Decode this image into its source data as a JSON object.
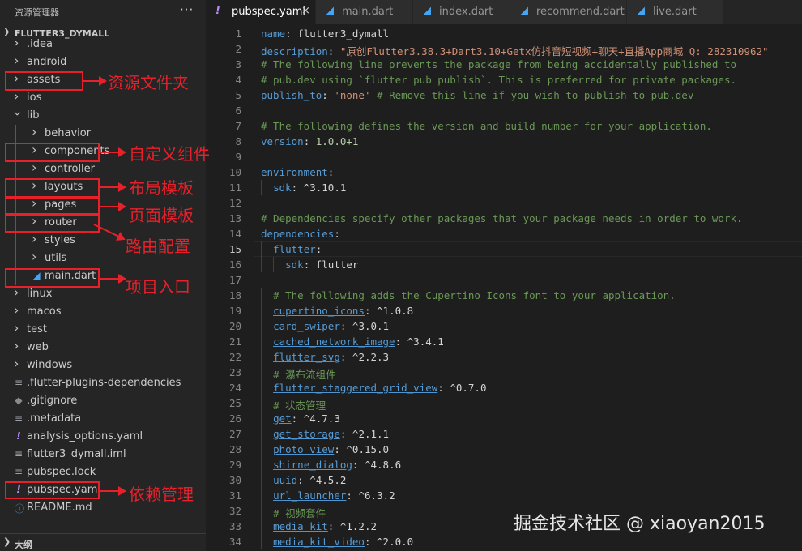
{
  "sidebar": {
    "title": "资源管理器",
    "more": "···",
    "root": "FLUTTER3_DYMALL",
    "outline": "大纲",
    "items": [
      {
        "label": ".idea",
        "kind": "folder"
      },
      {
        "label": "android",
        "kind": "folder"
      },
      {
        "label": "assets",
        "kind": "folder"
      },
      {
        "label": "ios",
        "kind": "folder"
      },
      {
        "label": "lib",
        "kind": "folder-open"
      },
      {
        "label": "behavior",
        "kind": "folder"
      },
      {
        "label": "components",
        "kind": "folder"
      },
      {
        "label": "controller",
        "kind": "folder"
      },
      {
        "label": "layouts",
        "kind": "folder"
      },
      {
        "label": "pages",
        "kind": "folder"
      },
      {
        "label": "router",
        "kind": "folder"
      },
      {
        "label": "styles",
        "kind": "folder"
      },
      {
        "label": "utils",
        "kind": "folder"
      },
      {
        "label": "main.dart",
        "kind": "dart"
      },
      {
        "label": "linux",
        "kind": "folder"
      },
      {
        "label": "macos",
        "kind": "folder"
      },
      {
        "label": "test",
        "kind": "folder"
      },
      {
        "label": "web",
        "kind": "folder"
      },
      {
        "label": "windows",
        "kind": "folder"
      },
      {
        "label": ".flutter-plugins-dependencies",
        "kind": "lines"
      },
      {
        "label": ".gitignore",
        "kind": "git"
      },
      {
        "label": ".metadata",
        "kind": "lines"
      },
      {
        "label": "analysis_options.yaml",
        "kind": "yaml"
      },
      {
        "label": "flutter3_dymall.iml",
        "kind": "lines"
      },
      {
        "label": "pubspec.lock",
        "kind": "lines"
      },
      {
        "label": "pubspec.yaml",
        "kind": "yaml"
      },
      {
        "label": "README.md",
        "kind": "info"
      }
    ]
  },
  "annotations": [
    {
      "label": "资源文件夹"
    },
    {
      "label": "自定义组件"
    },
    {
      "label": "布局模板"
    },
    {
      "label": "页面模板"
    },
    {
      "label": "路由配置"
    },
    {
      "label": "项目入口"
    },
    {
      "label": "依赖管理"
    }
  ],
  "tabs": [
    {
      "label": "pubspec.yaml",
      "icon": "!",
      "active": true,
      "close": "×"
    },
    {
      "label": "main.dart",
      "icon": "dart"
    },
    {
      "label": "index.dart",
      "icon": "dart"
    },
    {
      "label": "recommend.dart",
      "icon": "dart"
    },
    {
      "label": "live.dart",
      "icon": "dart"
    }
  ],
  "editor": {
    "current_line": 15,
    "lines": [
      [
        [
          "k",
          "name"
        ],
        [
          "p",
          ": "
        ],
        [
          "t",
          "flutter3_dymall"
        ]
      ],
      [
        [
          "k",
          "description"
        ],
        [
          "p",
          ": "
        ],
        [
          "s",
          "\"原创Flutter3.38.3+Dart3.10+Getx仿抖音短视频+聊天+直播App商城 Q: 282310962\""
        ]
      ],
      [
        [
          "c",
          "# The following line prevents the package from being accidentally published to"
        ]
      ],
      [
        [
          "c",
          "# pub.dev using `flutter pub publish`. This is preferred for private packages."
        ]
      ],
      [
        [
          "k",
          "publish_to"
        ],
        [
          "p",
          ": "
        ],
        [
          "s",
          "'none'"
        ],
        [
          "p",
          " "
        ],
        [
          "c",
          "# Remove this line if you wish to publish to pub.dev"
        ]
      ],
      [],
      [
        [
          "c",
          "# The following defines the version and build number for your application."
        ]
      ],
      [
        [
          "k",
          "version"
        ],
        [
          "p",
          ": "
        ],
        [
          "n",
          "1.0.0+1"
        ]
      ],
      [],
      [
        [
          "k",
          "environment"
        ],
        [
          "p",
          ":"
        ]
      ],
      [
        [
          "p",
          "  "
        ],
        [
          "k",
          "sdk"
        ],
        [
          "p",
          ": "
        ],
        [
          "t",
          "^3.10.1"
        ]
      ],
      [],
      [
        [
          "c",
          "# Dependencies specify other packages that your package needs in order to work."
        ]
      ],
      [
        [
          "k",
          "dependencies"
        ],
        [
          "p",
          ":"
        ]
      ],
      [
        [
          "p",
          "  "
        ],
        [
          "k",
          "flutter"
        ],
        [
          "p",
          ":"
        ]
      ],
      [
        [
          "p",
          "    "
        ],
        [
          "k",
          "sdk"
        ],
        [
          "p",
          ": "
        ],
        [
          "t",
          "flutter"
        ]
      ],
      [],
      [
        [
          "p",
          "  "
        ],
        [
          "c",
          "# The following adds the Cupertino Icons font to your application."
        ]
      ],
      [
        [
          "p",
          "  "
        ],
        [
          "ku",
          "cupertino_icons"
        ],
        [
          "p",
          ": "
        ],
        [
          "t",
          "^1.0.8"
        ]
      ],
      [
        [
          "p",
          "  "
        ],
        [
          "ku",
          "card_swiper"
        ],
        [
          "p",
          ": "
        ],
        [
          "t",
          "^3.0.1"
        ]
      ],
      [
        [
          "p",
          "  "
        ],
        [
          "ku",
          "cached_network_image"
        ],
        [
          "p",
          ": "
        ],
        [
          "t",
          "^3.4.1"
        ]
      ],
      [
        [
          "p",
          "  "
        ],
        [
          "ku",
          "flutter_svg"
        ],
        [
          "p",
          ": "
        ],
        [
          "t",
          "^2.2.3"
        ]
      ],
      [
        [
          "p",
          "  "
        ],
        [
          "c",
          "# 瀑布流组件"
        ]
      ],
      [
        [
          "p",
          "  "
        ],
        [
          "ku",
          "flutter_staggered_grid_view"
        ],
        [
          "p",
          ": "
        ],
        [
          "t",
          "^0.7.0"
        ]
      ],
      [
        [
          "p",
          "  "
        ],
        [
          "c",
          "# 状态管理"
        ]
      ],
      [
        [
          "p",
          "  "
        ],
        [
          "ku",
          "get"
        ],
        [
          "p",
          ": "
        ],
        [
          "t",
          "^4.7.3"
        ]
      ],
      [
        [
          "p",
          "  "
        ],
        [
          "ku",
          "get_storage"
        ],
        [
          "p",
          ": "
        ],
        [
          "t",
          "^2.1.1"
        ]
      ],
      [
        [
          "p",
          "  "
        ],
        [
          "ku",
          "photo_view"
        ],
        [
          "p",
          ": "
        ],
        [
          "t",
          "^0.15.0"
        ]
      ],
      [
        [
          "p",
          "  "
        ],
        [
          "ku",
          "shirne_dialog"
        ],
        [
          "p",
          ": "
        ],
        [
          "t",
          "^4.8.6"
        ]
      ],
      [
        [
          "p",
          "  "
        ],
        [
          "ku",
          "uuid"
        ],
        [
          "p",
          ": "
        ],
        [
          "t",
          "^4.5.2"
        ]
      ],
      [
        [
          "p",
          "  "
        ],
        [
          "ku",
          "url_launcher"
        ],
        [
          "p",
          ": "
        ],
        [
          "t",
          "^6.3.2"
        ]
      ],
      [
        [
          "p",
          "  "
        ],
        [
          "c",
          "# 视频套件"
        ]
      ],
      [
        [
          "p",
          "  "
        ],
        [
          "ku",
          "media_kit"
        ],
        [
          "p",
          ": "
        ],
        [
          "t",
          "^1.2.2"
        ]
      ],
      [
        [
          "p",
          "  "
        ],
        [
          "ku",
          "media_kit_video"
        ],
        [
          "p",
          ": "
        ],
        [
          "t",
          "^2.0.0"
        ]
      ]
    ]
  },
  "watermark": "掘金技术社区 @ xiaoyan2015",
  "colors": {
    "annotation": "#e8202a",
    "dart_icon": "#42a5f5",
    "yaml_icon": "#b88cf0",
    "git_icon": "#8a8a8a",
    "info_icon": "#519aba"
  }
}
